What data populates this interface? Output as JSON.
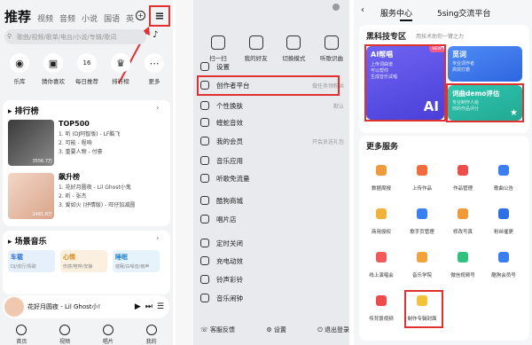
{
  "left": {
    "tabs": [
      "推荐",
      "视频",
      "音频",
      "小说",
      "国语",
      "英"
    ],
    "search_placeholder": "歌曲/视频/歌单/电台/小说/专辑/歌词",
    "shortcuts": [
      {
        "label": "乐库",
        "icon": "disc-icon"
      },
      {
        "label": "猜你喜欢",
        "icon": "radio-icon"
      },
      {
        "label": "每日推荐",
        "icon": "calendar-icon"
      },
      {
        "label": "排行榜",
        "icon": "trophy-icon"
      },
      {
        "label": "更多",
        "icon": "more-icon"
      }
    ],
    "ranking_title": "排行榜",
    "ranking": [
      {
        "name": "TOP500",
        "count": "3556.7万",
        "songs": [
          "1. 听 (DJ阿智版) - LF酷飞",
          "2. 可能 - 程响",
          "3. 重要人物 - 付豪"
        ]
      },
      {
        "name": "飙升榜",
        "count": "1481.8万",
        "songs": [
          "1. 花好月圆夜 - Lil Ghost小鬼",
          "2. 听 - 张杰",
          "3. 爱如火 (抒情版) - 旺仔加减圆"
        ]
      }
    ],
    "scene_title": "场景音乐",
    "scenes": [
      {
        "name": "车载",
        "sub": "DJ/流行/情歌"
      },
      {
        "name": "心情",
        "sub": "伤感/喧哗/安静"
      },
      {
        "name": "睡眠",
        "sub": "催眠/白噪音/雨声"
      }
    ],
    "player_text": "花好月圆夜 - Lil Ghost小!",
    "nav": [
      "首页",
      "视频",
      "唱片",
      "我的"
    ]
  },
  "mid": {
    "top_items": [
      "扫一扫",
      "我的好友",
      "切换模式",
      "听歌识曲"
    ],
    "menu": [
      {
        "label": "设置",
        "right": ""
      },
      {
        "label": "创作者平台",
        "right": "做任务领粉丝"
      },
      {
        "label": "个性换肤",
        "right": "默认"
      },
      {
        "label": "蝰蛇音效",
        "right": ""
      },
      {
        "label": "我的会员",
        "right": "开会员送礼包"
      },
      {
        "label": "音乐应用",
        "right": ""
      },
      {
        "label": "听歌免流量",
        "right": ""
      },
      {
        "label": "酷狗商城",
        "right": ""
      },
      {
        "label": "唱片店",
        "right": ""
      },
      {
        "label": "定时关闭",
        "right": ""
      },
      {
        "label": "充电动效",
        "right": ""
      },
      {
        "label": "铃声彩铃",
        "right": ""
      },
      {
        "label": "音乐闹钟",
        "right": ""
      }
    ],
    "footer": [
      "客服反馈",
      "设置",
      "退出登录"
    ]
  },
  "right": {
    "tabs": [
      "服务中心",
      "5sing交流平台"
    ],
    "section1_title": "黑科技专区",
    "section1_sub": "用技术助你一臂之力",
    "ai_card": {
      "title": "AI帮唱",
      "desc": "上传词曲谱\n可以帮你\n生成音乐试唱",
      "badge": "NEW",
      "big": "AI"
    },
    "card2": {
      "title": "觅词",
      "desc": "专业词作者\n高效打磨"
    },
    "card3": {
      "title": "词曲demo评估",
      "desc": "专业制作人给\n你的作品评分"
    },
    "section2_title": "更多服务",
    "services": [
      {
        "label": "数据周报",
        "color": "#f09a3e"
      },
      {
        "label": "上传作品",
        "color": "#f26b3a"
      },
      {
        "label": "作品管理",
        "color": "#ee4d4d"
      },
      {
        "label": "歌曲公告",
        "color": "#3a7ff2"
      },
      {
        "label": "商用授权",
        "color": "#f2b23a"
      },
      {
        "label": "歌手页管理",
        "color": "#3a7ff2"
      },
      {
        "label": "修改写真",
        "color": "#f29a3a"
      },
      {
        "label": "粉丝催更",
        "color": "#2e6ee6"
      },
      {
        "label": "线上演唱会",
        "color": "#f25a5a"
      },
      {
        "label": "音乐学院",
        "color": "#f2a23a"
      },
      {
        "label": "微信视频号",
        "color": "#2ec27e"
      },
      {
        "label": "酷狗会员号",
        "color": "#3a7ff2"
      },
      {
        "label": "传背景视频",
        "color": "#ef4b4b"
      },
      {
        "label": "制作专辑封面",
        "color": "#f2c23a"
      }
    ]
  }
}
